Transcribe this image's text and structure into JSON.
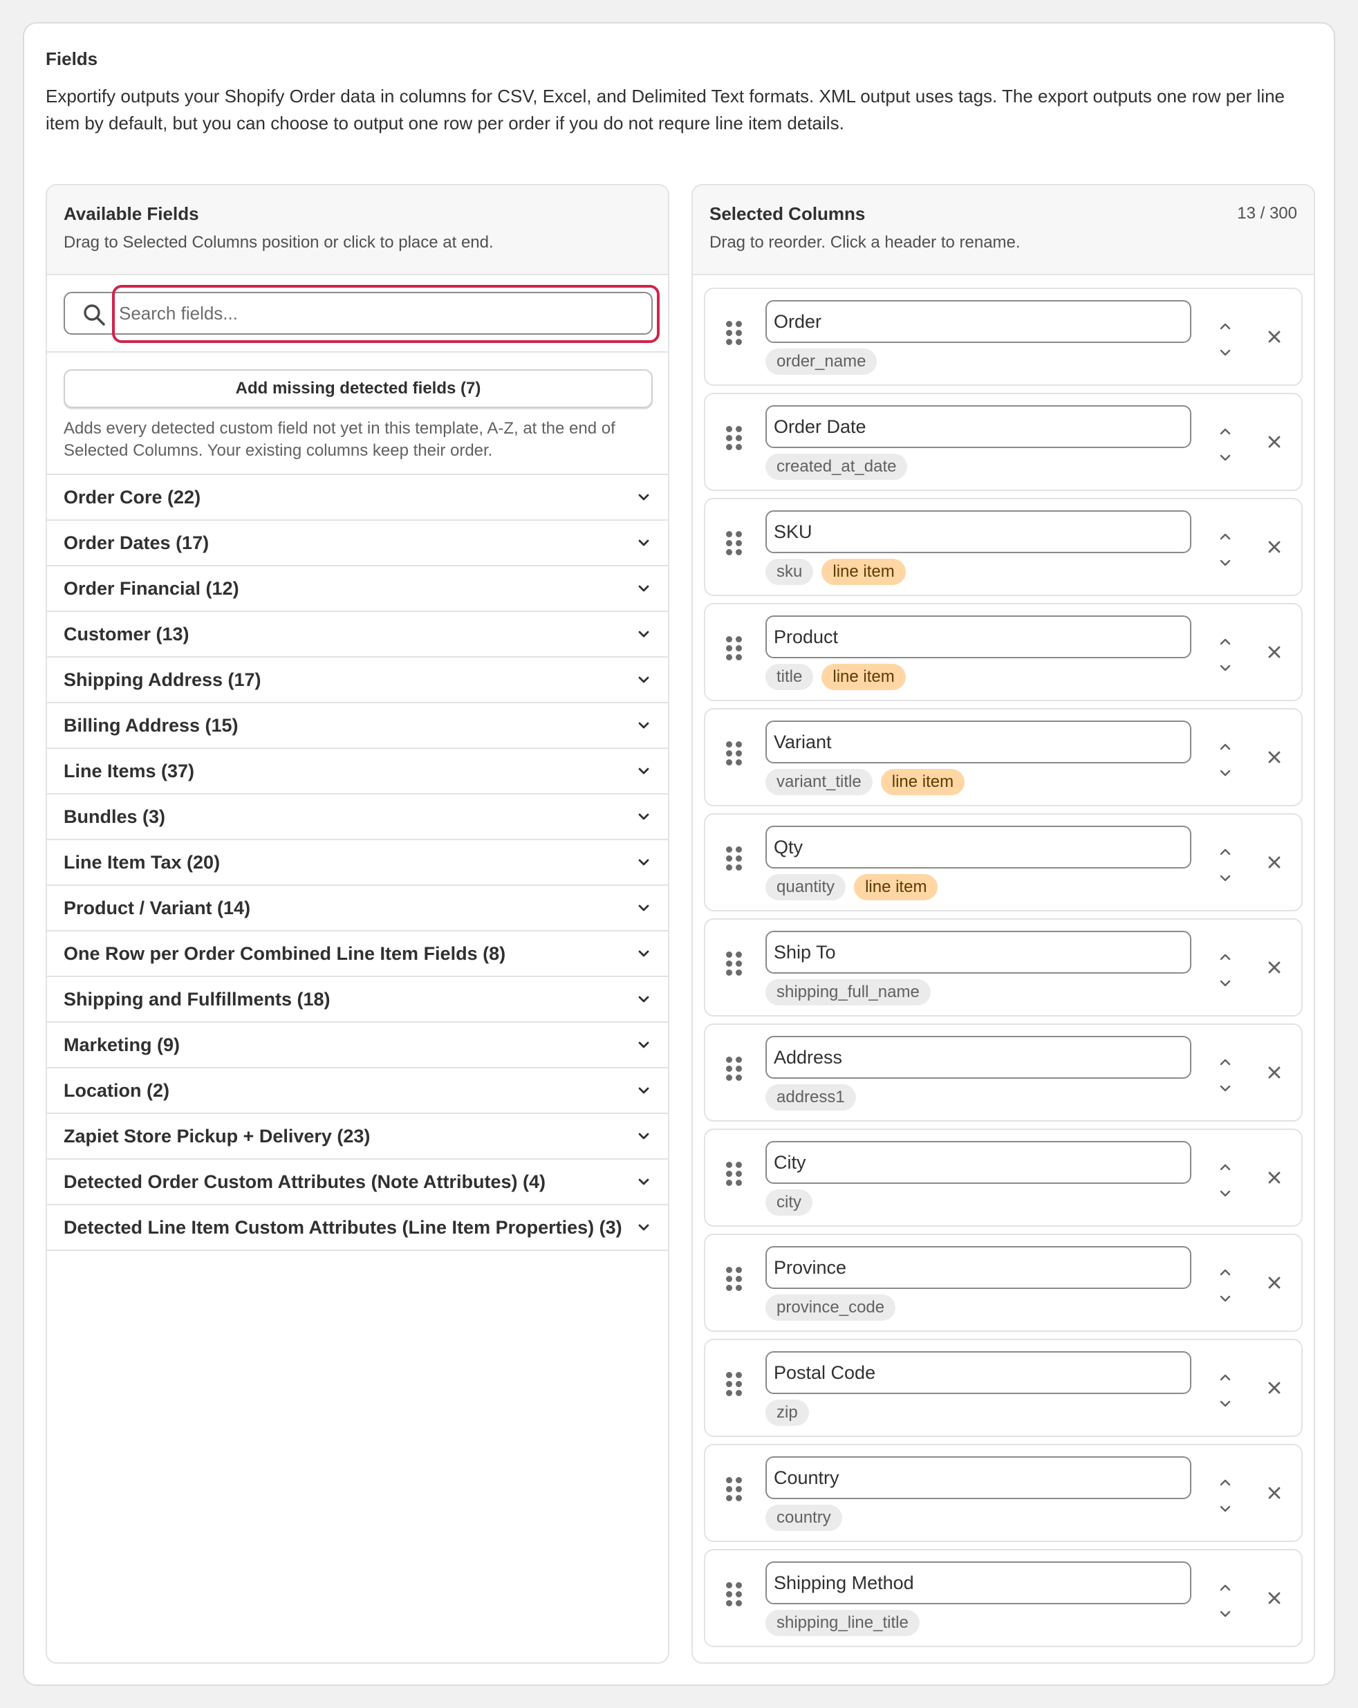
{
  "section": {
    "title": "Fields",
    "description": "Exportify outputs your Shopify Order data in columns for CSV, Excel, and Delimited Text formats. XML output uses tags. The export outputs one row per line item by default, but you can choose to output one row per order if you do not requre line item details."
  },
  "available": {
    "title": "Available Fields",
    "subtitle": "Drag to Selected Columns position or click to place at end.",
    "search_placeholder": "Search fields...",
    "add_missing_label": "Add missing detected fields (7)",
    "add_missing_note": "Adds every detected custom field not yet in this template, A-Z, at the end of Selected Columns. Your existing columns keep their order.",
    "groups": [
      "Order Core (22)",
      "Order Dates (17)",
      "Order Financial (12)",
      "Customer (13)",
      "Shipping Address (17)",
      "Billing Address (15)",
      "Line Items (37)",
      "Bundles (3)",
      "Line Item Tax (20)",
      "Product / Variant (14)",
      "One Row per Order Combined Line Item Fields (8)",
      "Shipping and Fulfillments (18)",
      "Marketing (9)",
      "Location (2)",
      "Zapiet Store Pickup + Delivery (23)",
      "Detected Order Custom Attributes (Note Attributes) (4)",
      "Detected Line Item Custom Attributes (Line Item Properties) (3)"
    ]
  },
  "selected": {
    "title": "Selected Columns",
    "subtitle": "Drag to reorder. Click a header to rename.",
    "count": "13 / 300",
    "line_item_tag": "line item",
    "columns": [
      {
        "name": "Order",
        "field": "order_name",
        "line_item": false
      },
      {
        "name": "Order Date",
        "field": "created_at_date",
        "line_item": false
      },
      {
        "name": "SKU",
        "field": "sku",
        "line_item": true
      },
      {
        "name": "Product",
        "field": "title",
        "line_item": true
      },
      {
        "name": "Variant",
        "field": "variant_title",
        "line_item": true
      },
      {
        "name": "Qty",
        "field": "quantity",
        "line_item": true
      },
      {
        "name": "Ship To",
        "field": "shipping_full_name",
        "line_item": false
      },
      {
        "name": "Address",
        "field": "address1",
        "line_item": false
      },
      {
        "name": "City",
        "field": "city",
        "line_item": false
      },
      {
        "name": "Province",
        "field": "province_code",
        "line_item": false
      },
      {
        "name": "Postal Code",
        "field": "zip",
        "line_item": false
      },
      {
        "name": "Country",
        "field": "country",
        "line_item": false
      },
      {
        "name": "Shipping Method",
        "field": "shipping_line_title",
        "line_item": false
      }
    ]
  },
  "colors": {
    "accent_focus": "#d0244c",
    "line_item_tag_bg": "#ffd6a4"
  },
  "icons": {
    "search": "search-icon",
    "chevron": "chevron-down-icon",
    "grip": "drag-handle-icon",
    "up": "chevron-up-icon",
    "down": "chevron-down-icon",
    "remove": "close-icon"
  }
}
